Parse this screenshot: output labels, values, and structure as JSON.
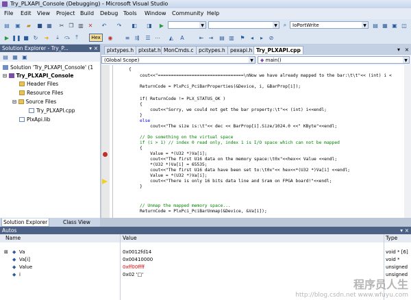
{
  "window": {
    "title": "Try_PLXAPI_Console (Debugging) - Microsoft Visual Studio"
  },
  "menu": [
    "File",
    "Edit",
    "View",
    "Project",
    "Build",
    "Debug",
    "Tools",
    "Window",
    "Community",
    "Help"
  ],
  "toolbar": {
    "hex_label": "Hex",
    "find_combo": "IoPortWrite",
    "config_combo": "",
    "platform_combo": ""
  },
  "solution_explorer": {
    "title": "Solution Explorer - Try_P...",
    "solution": "Solution 'Try_PLXAPI_Console' (1",
    "project": "Try_PLXAPI_Console",
    "items": [
      {
        "label": "Header Files",
        "type": "folder"
      },
      {
        "label": "Resource Files",
        "type": "folder"
      },
      {
        "label": "Source Files",
        "type": "folder"
      },
      {
        "label": "Try_PLXAPI.cpp",
        "type": "file"
      },
      {
        "label": "PlxApi.lib",
        "type": "file"
      }
    ],
    "tabs": [
      "Solution Explorer",
      "Class View"
    ]
  },
  "editor": {
    "tabs": [
      "plxtypes.h",
      "plxstat.h",
      "MonCmds.c",
      "pcitypes.h",
      "pexapi.h",
      "Try_PLXAPI.cpp"
    ],
    "active_tab": "Try_PLXAPI.cpp",
    "scope": "(Global Scope)",
    "function": "main()",
    "lines": [
      "{",
      "cout<<\"=================================\\nNow we have already mapped to the bar:\\t\\t\"<< (int) i <",
      "",
      "ReturnCode = PlxPci_PciBarProperties(&Device, i, &BarProp[i]);",
      "",
      "if( ReturnCode != PLX_STATUS_OK )",
      "{",
      "    cout<<\"Sorry, we could not get the bar property:\\t\"<< (int) i<<endl;",
      "}",
      "else",
      "    cout<<\"The size is:\\t\"<< dec << BarProp[i].Size/1024.0 <<\" KByte\"<<endl;",
      "",
      "// Do something on the virtual space",
      "if (i > 1) // index 0 read only, index 1 is I/O space which can not be mapped",
      "{",
      "    Value = *(U32 *)Va[i];",
      "    cout<<\"The first U16 data on the memory space:\\t0x\"<<hex<< Value <<endl;",
      "    *(U32 *)Va[i] = 65535;",
      "    cout<<\"The first U16 data have been set to:\\t0x\"<< hex<<*(U32 *)Va[i] <<endl;",
      "    Value = *(U32 *)Va[i];",
      "    cout<<\"There is only 16 bits data line and Sram on FPGA board!\"<<endl;",
      "}",
      "",
      "",
      "",
      "// Unmap the mapped memory space...",
      "ReturnCode = PlxPci_PciBarUnmap(&Device, &Va[i]);"
    ]
  },
  "autos": {
    "title": "Autos",
    "columns": [
      "Name",
      "Value",
      "Type"
    ],
    "rows": [
      {
        "name": "Va",
        "value": "0x0012fd14",
        "type": "void * [6]",
        "expandable": true,
        "changed": false
      },
      {
        "name": "Va[i]",
        "value": "0x00410000",
        "type": "void *",
        "expandable": false,
        "changed": false
      },
      {
        "name": "Value",
        "value": "0xff00ffff",
        "type": "unsigned",
        "expandable": false,
        "changed": true
      },
      {
        "name": "i",
        "value": "0x02 '□'",
        "type": "unsigned",
        "expandable": false,
        "changed": false
      }
    ]
  },
  "watermark": {
    "text": "程序员人生",
    "url": "http://blog.csdn.net www.wfuyu.com"
  }
}
